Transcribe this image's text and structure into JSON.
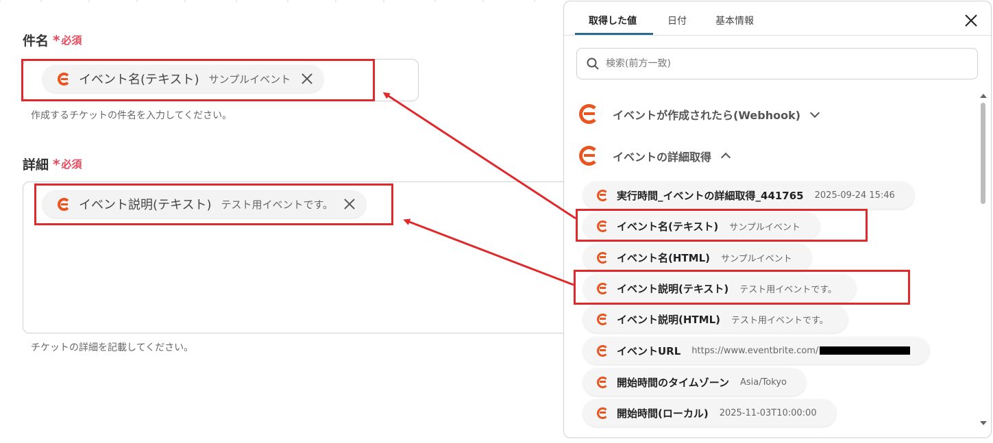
{
  "colors": {
    "accent_red": "#e0292b",
    "required": "#e8475a",
    "brand_orange": "#e9541f"
  },
  "form": {
    "subject": {
      "label": "件名",
      "required": "必須",
      "required_mark": "*",
      "chip_title": "イベント名(テキスト)",
      "chip_value": "サンプルイベント",
      "hint": "作成するチケットの件名を入力してください。"
    },
    "details": {
      "label": "詳細",
      "required": "必須",
      "required_mark": "*",
      "chip_title": "イベント説明(テキスト)",
      "chip_value": "テスト用イベントです。",
      "hint": "チケットの詳細を記載してください。"
    }
  },
  "panel": {
    "tabs": [
      "取得した値",
      "日付",
      "基本情報"
    ],
    "search_placeholder": "検索(前方一致)",
    "groups": [
      {
        "label": "イベントが作成されたら(Webhook)",
        "state": "collapsed"
      },
      {
        "label": "イベントの詳細取得",
        "state": "expanded"
      }
    ],
    "items": [
      {
        "title": "実行時間_イベントの詳細取得_441765",
        "value": "2025-09-24 15:46"
      },
      {
        "title": "イベント名(テキスト)",
        "value": "サンプルイベント"
      },
      {
        "title": "イベント名(HTML)",
        "value": "サンプルイベント"
      },
      {
        "title": "イベント説明(テキスト)",
        "value": "テスト用イベントです。"
      },
      {
        "title": "イベント説明(HTML)",
        "value": "テスト用イベントです。"
      },
      {
        "title": "イベントURL",
        "value": "https://www.eventbrite.com/"
      },
      {
        "title": "開始時間のタイムゾーン",
        "value": "Asia/Tokyo"
      },
      {
        "title": "開始時間(ローカル)",
        "value": "2025-11-03T10:00:00"
      }
    ]
  }
}
